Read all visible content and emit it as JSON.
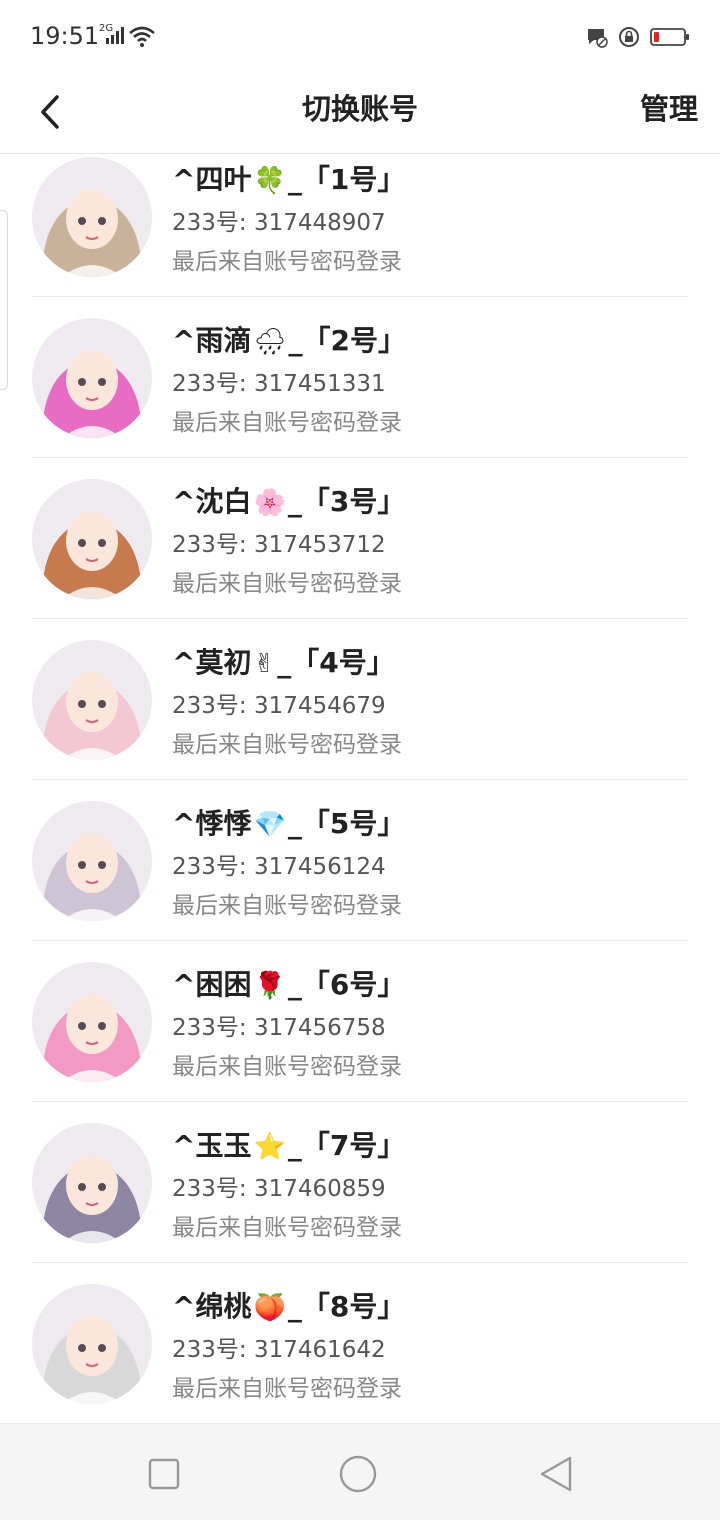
{
  "status_bar": {
    "time": "19:51",
    "network_type": "2G"
  },
  "header": {
    "title": "切换账号",
    "manage_label": "管理"
  },
  "accounts": [
    {
      "prefix": "^四叶",
      "emoji": "🍀",
      "suffix": "_「1号」",
      "id_text": "233号: 317448907",
      "source": "最后来自账号密码登录",
      "avatar_color": "#c9b29a"
    },
    {
      "prefix": "^雨滴",
      "emoji": "🌧",
      "suffix": "_「2号」",
      "id_text": "233号: 317451331",
      "source": "最后来自账号密码登录",
      "avatar_color": "#e86bc4"
    },
    {
      "prefix": "^沈白",
      "emoji": "🌸",
      "suffix": "_「3号」",
      "id_text": "233号: 317453712",
      "source": "最后来自账号密码登录",
      "avatar_color": "#c67a4e"
    },
    {
      "prefix": "^莫初",
      "emoji": "✌",
      "suffix": "_「4号」",
      "id_text": "233号: 317454679",
      "source": "最后来自账号密码登录",
      "avatar_color": "#f3c8d2"
    },
    {
      "prefix": "^悸悸",
      "emoji": "💎",
      "suffix": "_「5号」",
      "id_text": "233号: 317456124",
      "source": "最后来自账号密码登录",
      "avatar_color": "#cfc3d6"
    },
    {
      "prefix": "^困困",
      "emoji": "🌹",
      "suffix": "_「6号」",
      "id_text": "233号: 317456758",
      "source": "最后来自账号密码登录",
      "avatar_color": "#f29ac4"
    },
    {
      "prefix": "^玉玉",
      "emoji": "⭐",
      "suffix": "_「7号」",
      "id_text": "233号: 317460859",
      "source": "最后来自账号密码登录",
      "avatar_color": "#8e86a3"
    },
    {
      "prefix": "^绵桃",
      "emoji": "🍑",
      "suffix": "_「8号」",
      "id_text": "233号: 317461642",
      "source": "最后来自账号密码登录",
      "avatar_color": "#d8d8d8"
    }
  ],
  "colors": {
    "title_text": "#222222",
    "id_text": "#555555",
    "source_text": "#888888",
    "divider": "#e8e8e8",
    "nav_bar_bg": "#f5f5f5",
    "battery_low": "#e32222"
  }
}
